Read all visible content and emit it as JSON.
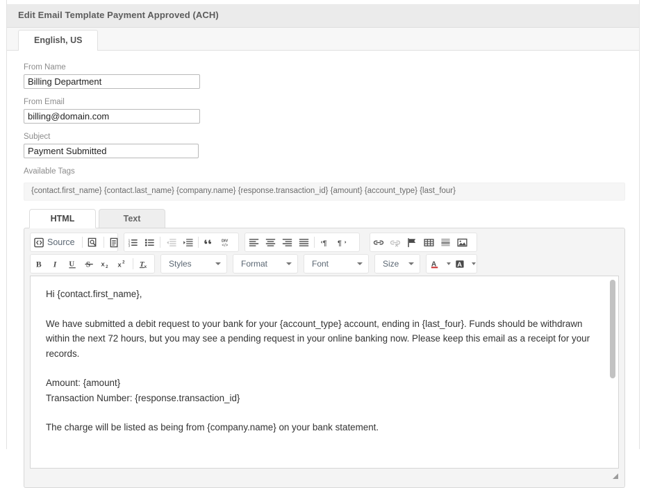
{
  "header": {
    "title": "Edit Email Template Payment Approved (ACH)"
  },
  "locale_tabs": [
    {
      "label": "English, US",
      "active": true
    }
  ],
  "form": {
    "from_name": {
      "label": "From Name",
      "value": "Billing Department",
      "placeholder": ""
    },
    "from_email": {
      "label": "From Email",
      "value": "billing@domain.com",
      "placeholder": ""
    },
    "subject": {
      "label": "Subject",
      "value": "Payment Submitted",
      "placeholder": ""
    }
  },
  "available_tags": {
    "label": "Available Tags",
    "text": "{contact.first_name} {contact.last_name} {company.name} {response.transaction_id} {amount} {account_type} {last_four}",
    "tokens": [
      "{contact.first_name}",
      "{contact.last_name}",
      "{company.name}",
      "{response.transaction_id}",
      "{amount}",
      "{account_type}",
      "{last_four}"
    ]
  },
  "format_tabs": [
    {
      "label": "HTML",
      "active": true
    },
    {
      "label": "Text",
      "active": false
    }
  ],
  "editor": {
    "toolbar": {
      "source_label": "Source",
      "row1": [
        {
          "name": "source-button",
          "label": "Source"
        },
        {
          "name": "preview-icon",
          "label": "Preview"
        },
        {
          "name": "templates-icon",
          "label": "Templates"
        },
        {
          "name": "numbered-list-icon",
          "label": "Insert/Remove Numbered List"
        },
        {
          "name": "bulleted-list-icon",
          "label": "Insert/Remove Bulleted List"
        },
        {
          "name": "decrease-indent-icon",
          "label": "Decrease Indent"
        },
        {
          "name": "increase-indent-icon",
          "label": "Increase Indent"
        },
        {
          "name": "blockquote-icon",
          "label": "Block Quote"
        },
        {
          "name": "create-div-icon",
          "label": "Create Div Container"
        },
        {
          "name": "align-left-icon",
          "label": "Align Left"
        },
        {
          "name": "align-center-icon",
          "label": "Center"
        },
        {
          "name": "align-right-icon",
          "label": "Align Right"
        },
        {
          "name": "justify-icon",
          "label": "Justify"
        },
        {
          "name": "ltr-icon",
          "label": "Text direction from left to right"
        },
        {
          "name": "rtl-icon",
          "label": "Text direction from right to left"
        },
        {
          "name": "link-icon",
          "label": "Link"
        },
        {
          "name": "unlink-icon",
          "label": "Unlink"
        },
        {
          "name": "anchor-icon",
          "label": "Anchor"
        },
        {
          "name": "table-icon",
          "label": "Table"
        },
        {
          "name": "horizontal-rule-icon",
          "label": "Horizontal Line"
        },
        {
          "name": "image-icon",
          "label": "Image"
        }
      ],
      "row2": [
        {
          "name": "bold-icon",
          "label": "Bold"
        },
        {
          "name": "italic-icon",
          "label": "Italic"
        },
        {
          "name": "underline-icon",
          "label": "Underline"
        },
        {
          "name": "strikethrough-icon",
          "label": "Strikethrough"
        },
        {
          "name": "subscript-icon",
          "label": "Subscript"
        },
        {
          "name": "superscript-icon",
          "label": "Superscript"
        },
        {
          "name": "remove-format-icon",
          "label": "Remove Format"
        }
      ],
      "dropdowns": [
        {
          "name": "styles-dropdown",
          "label": "Styles"
        },
        {
          "name": "format-dropdown",
          "label": "Format"
        },
        {
          "name": "font-dropdown",
          "label": "Font"
        },
        {
          "name": "size-dropdown",
          "label": "Size"
        }
      ],
      "color_buttons": [
        {
          "name": "text-color-button",
          "label": "Text Color"
        },
        {
          "name": "background-color-button",
          "label": "Background Color"
        }
      ]
    },
    "content": {
      "greeting": "Hi {contact.first_name},",
      "paragraph_1": "We have submitted a debit request to your bank for your {account_type} account, ending in {last_four}. Funds should be withdrawn within the next 72 hours, but you may see a pending request in your online banking now. Please keep this email as a receipt for your records.",
      "amount_line": "Amount: {amount}",
      "transaction_line": "Transaction Number: {response.transaction_id}",
      "paragraph_2": "The charge will be listed as being from {company.name} on your bank statement."
    }
  },
  "colors": {
    "header_bg": "#ebebeb",
    "header_text": "#5c5c5c",
    "tab_active_bg": "#ffffff",
    "panel_border": "#e2e2e2",
    "tags_bg": "#f6f6f6",
    "editor_chrome_bg": "#f4f4f4",
    "text_color_accent": "#cc3333",
    "body_text": "#333333",
    "label_text": "#8b8b8b",
    "scrollbar_thumb": "#c2c2c2"
  }
}
